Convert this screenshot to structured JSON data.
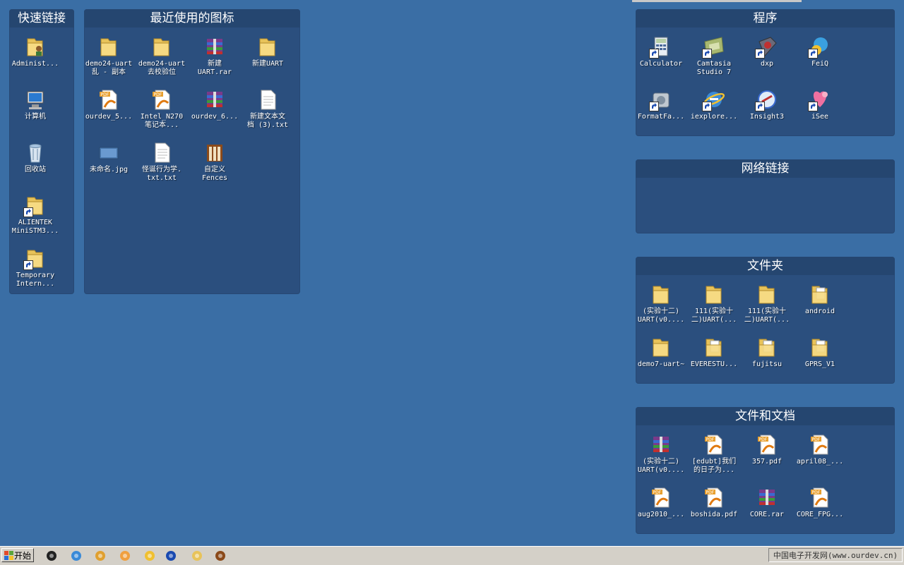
{
  "fences": {
    "quick": {
      "title": "快速链接",
      "items": [
        {
          "label": "Administ...",
          "icon": "user-folder-icon"
        },
        {
          "label": "计算机",
          "icon": "computer-icon"
        },
        {
          "label": "回收站",
          "icon": "recycle-bin-icon"
        },
        {
          "label": "ALIENTEK\nMiniSTM3...",
          "icon": "folder-shortcut-icon"
        },
        {
          "label": "Temporary\nIntern...",
          "icon": "folder-shortcut-icon"
        }
      ]
    },
    "recent": {
      "title": "最近使用的图标",
      "items": [
        {
          "label": "demo24-uart\n乱 - 副本",
          "icon": "folder-icon"
        },
        {
          "label": "demo24-uart\n去校验位",
          "icon": "folder-icon"
        },
        {
          "label": "新建\nUART.rar",
          "icon": "rar-icon"
        },
        {
          "label": "新建UART",
          "icon": "folder-icon"
        },
        {
          "label": "ourdev_5...",
          "icon": "pdf-icon"
        },
        {
          "label": "Intel_N270\n笔记本...",
          "icon": "pdf-icon"
        },
        {
          "label": "ourdev_6...",
          "icon": "rar-icon"
        },
        {
          "label": "新建文本文\n档 (3).txt",
          "icon": "text-file-icon"
        },
        {
          "label": "未命名.jpg",
          "icon": "image-icon"
        },
        {
          "label": "怪诞行为学.\ntxt.txt",
          "icon": "text-file-icon"
        },
        {
          "label": "自定义\nFences",
          "icon": "fences-icon"
        }
      ]
    },
    "programs": {
      "title": "程序",
      "items": [
        {
          "label": "Calculator",
          "icon": "calculator-icon"
        },
        {
          "label": "Camtasia\nStudio 7",
          "icon": "camtasia-icon"
        },
        {
          "label": "dxp",
          "icon": "dxp-icon"
        },
        {
          "label": "FeiQ",
          "icon": "feiq-icon"
        },
        {
          "label": "FormatFa...",
          "icon": "formatfactory-icon"
        },
        {
          "label": "iexplore...",
          "icon": "ie-icon"
        },
        {
          "label": "Insight3",
          "icon": "insight-icon"
        },
        {
          "label": "iSee",
          "icon": "isee-icon"
        }
      ]
    },
    "network": {
      "title": "网络链接",
      "items": []
    },
    "folders": {
      "title": "文件夹",
      "items": [
        {
          "label": "(实验十二)\nUART(v0....",
          "icon": "folder-icon"
        },
        {
          "label": "111(实验十\n二)UART(...",
          "icon": "folder-icon"
        },
        {
          "label": "111(实验十\n二)UART(...",
          "icon": "folder-icon"
        },
        {
          "label": "android",
          "icon": "folder-doc-icon"
        },
        {
          "label": "demo7-uart~",
          "icon": "folder-icon"
        },
        {
          "label": "EVERESTU...",
          "icon": "folder-doc-icon"
        },
        {
          "label": "fujitsu",
          "icon": "folder-doc-icon"
        },
        {
          "label": "GPRS_V1",
          "icon": "folder-doc-icon"
        }
      ]
    },
    "docs": {
      "title": "文件和文档",
      "items": [
        {
          "label": "(实验十二)\nUART(v0....",
          "icon": "rar-icon"
        },
        {
          "label": "[edubt]我们\n的日子为...",
          "icon": "pdf-icon"
        },
        {
          "label": "357.pdf",
          "icon": "pdf-icon"
        },
        {
          "label": "april08_...",
          "icon": "pdf-icon"
        },
        {
          "label": "aug2010_...",
          "icon": "pdf-icon"
        },
        {
          "label": "boshida.pdf",
          "icon": "pdf-icon"
        },
        {
          "label": "CORE.rar",
          "icon": "rar-icon"
        },
        {
          "label": "CORE_FPG...",
          "icon": "pdf-icon"
        }
      ]
    }
  },
  "taskbar": {
    "start_label": "开始",
    "icons": [
      "qq-icon",
      "browser-icon",
      "paint-icon",
      "face-icon",
      "bulb-icon",
      "s-app-icon",
      "explorer-icon",
      "fences-icon"
    ],
    "tray_text": "中国电子开发网(www.ourdev.cn)"
  }
}
